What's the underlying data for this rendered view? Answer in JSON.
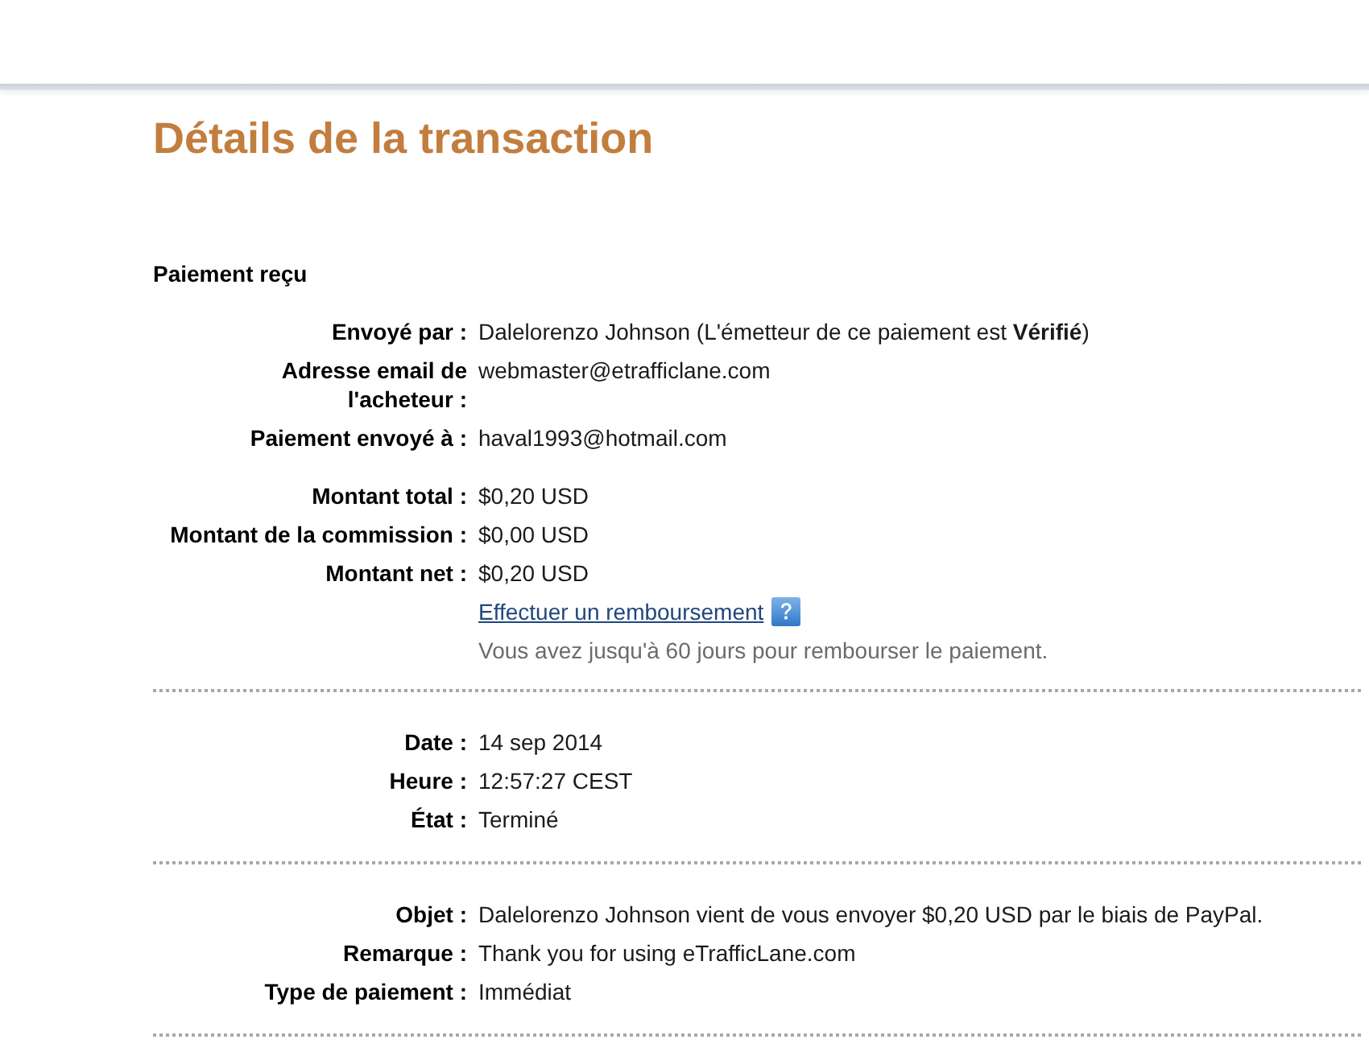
{
  "page": {
    "title": "Détails de la transaction"
  },
  "sections": [
    {
      "heading": "Paiement reçu",
      "groups": [
        [
          {
            "kind": "field",
            "label": "Envoyé par :",
            "value": "Dalelorenzo Johnson (L'émetteur de ce paiement est **Vérifié**)"
          },
          {
            "kind": "field",
            "label": "Adresse email de l'acheteur :",
            "value": "webmaster@etrafficlane.com"
          },
          {
            "kind": "field",
            "label": "Paiement envoyé à :",
            "value": "haval1993@hotmail.com"
          }
        ],
        [
          {
            "kind": "field",
            "label": "Montant total :",
            "value": "$0,20 USD"
          },
          {
            "kind": "field",
            "label": "Montant de la commission :",
            "value": "$0,00 USD"
          },
          {
            "kind": "field",
            "label": "Montant net :",
            "value": "$0,20 USD"
          },
          {
            "kind": "link",
            "text": "Effectuer un remboursement"
          },
          {
            "kind": "note",
            "text": "Vous avez jusqu'à 60 jours pour rembourser le paiement."
          }
        ]
      ]
    },
    {
      "groups": [
        [
          {
            "kind": "field",
            "label": "Date :",
            "value": "14 sep 2014"
          },
          {
            "kind": "field",
            "label": "Heure :",
            "value": "12:57:27 CEST"
          },
          {
            "kind": "field",
            "label": "État :",
            "value": "Terminé"
          }
        ]
      ]
    },
    {
      "groups": [
        [
          {
            "kind": "field",
            "label": "Objet :",
            "value": "Dalelorenzo Johnson vient de vous envoyer $0,20 USD par le biais de PayPal."
          },
          {
            "kind": "field",
            "label": "Remarque :",
            "value": "Thank you for using eTrafficLane.com"
          },
          {
            "kind": "field",
            "label": "Type de paiement :",
            "value": "Immédiat"
          }
        ]
      ]
    }
  ]
}
